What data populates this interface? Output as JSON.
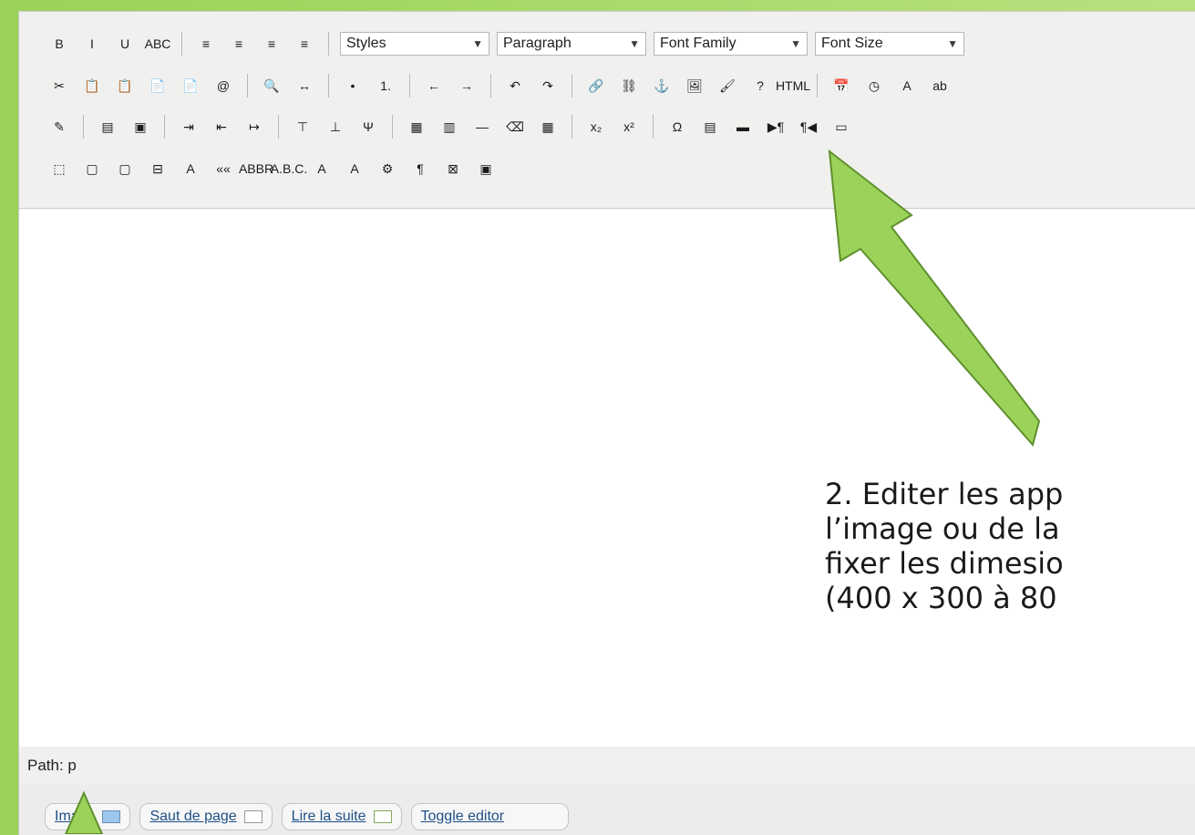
{
  "toolbar": {
    "row1": [
      "B",
      "I",
      "U",
      "ABC",
      "≡",
      "≡",
      "≡",
      "≡"
    ],
    "selects": [
      {
        "label": "Styles"
      },
      {
        "label": "Paragraph"
      },
      {
        "label": "Font Family"
      },
      {
        "label": "Font Size"
      }
    ],
    "row2": [
      "✂",
      "📋",
      "📋",
      "📄",
      "📄",
      "@",
      "🔍",
      "↔",
      "•",
      "1.",
      "←",
      "→",
      "↶",
      "↷",
      "🔗",
      "⛓",
      "⚓",
      "🖼",
      "🖌",
      "?",
      "HTML",
      "📅",
      "◷",
      "A",
      "ab"
    ],
    "row3": [
      "✎",
      "▤",
      "▣",
      "⇥",
      "⇤",
      "↦",
      "⊤",
      "⊥",
      "Ψ",
      "▦",
      "▥",
      "—",
      "⌫",
      "▦",
      "x₂",
      "x²",
      "Ω",
      "▤",
      "▬",
      "▶¶",
      "¶◀",
      "▭"
    ],
    "row4": [
      "⬚",
      "▢",
      "▢",
      "⊟",
      "A",
      "««",
      "ABBR",
      "A.B.C.",
      "A",
      "A",
      "⚙",
      "¶",
      "⊠",
      "▣"
    ]
  },
  "status": {
    "path": "Path: p"
  },
  "buttons": [
    {
      "label": "Image"
    },
    {
      "label": "Saut de page"
    },
    {
      "label": "Lire la suite"
    },
    {
      "label": "Toggle editor"
    }
  ],
  "annotation": {
    "lines": [
      "2. Editer les app",
      "l’image ou de la",
      "fixer les dimesio",
      "(400 x 300 à 80"
    ]
  },
  "colors": {
    "arrow_fill": "#9bd35a",
    "arrow_stroke": "#5f8f2e"
  }
}
